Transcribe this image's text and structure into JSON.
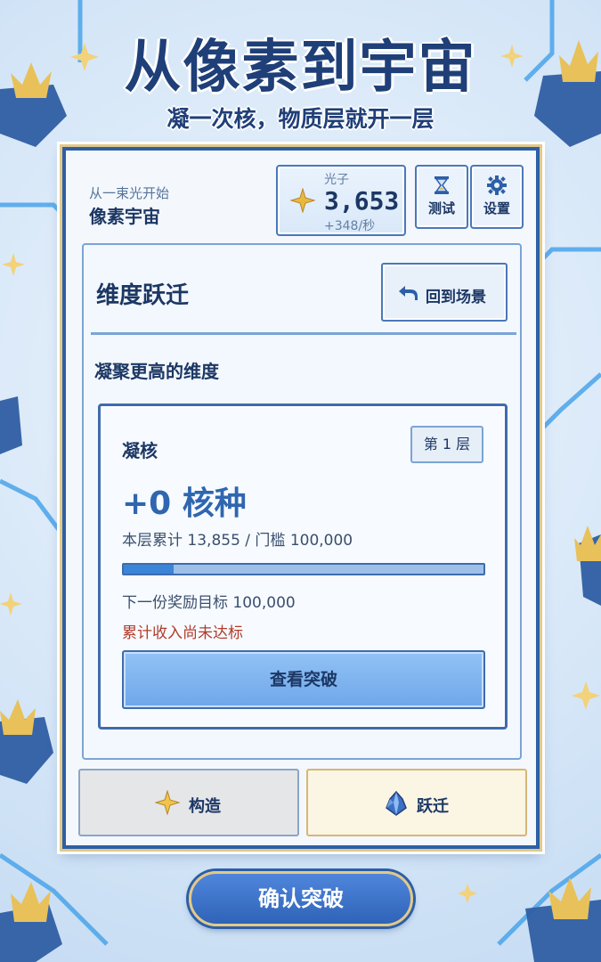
{
  "title": "从像素到宇宙",
  "subtitle": "凝一次核，物质层就开一层",
  "header": {
    "tagline": "从一束光开始",
    "game_name": "像素宇宙",
    "currency": {
      "label": "光子",
      "amount": "3,653",
      "rate": "+348/秒",
      "icon": "sparkle-icon"
    },
    "test_button": {
      "label": "测试",
      "icon": "hourglass-icon"
    },
    "settings_button": {
      "label": "设置",
      "icon": "gear-icon"
    }
  },
  "dimension": {
    "title": "维度跃迁",
    "back_button": "回到场景",
    "section_title": "凝聚更高的维度",
    "card": {
      "title": "凝核",
      "layer_badge": "第 1 层",
      "gain": "+0 核种",
      "accumulated": "本层累计 13,855 / 门槛 100,000",
      "progress": 0.1386,
      "next_reward": "下一份奖励目标 100,000",
      "warning": "累计收入尚未达标",
      "view_button": "查看突破"
    }
  },
  "tabs": {
    "build": {
      "label": "构造",
      "icon": "sparkle-icon"
    },
    "jump": {
      "label": "跃迁",
      "icon": "crystal-icon"
    }
  },
  "confirm_button": "确认突破",
  "colors": {
    "primary": "#2c5fa6",
    "accent_gold": "#e2c98a",
    "warning": "#b23b2b",
    "progress_fill": "#3a85d8"
  }
}
